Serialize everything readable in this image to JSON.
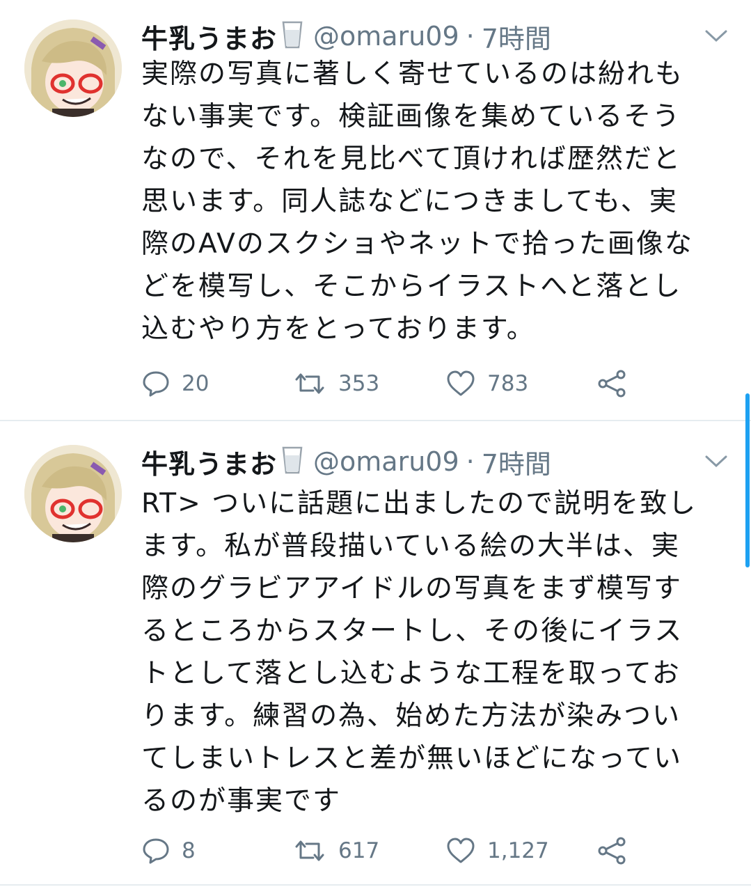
{
  "tweets": [
    {
      "name": "牛乳うまお",
      "name_emoji": "milk-glass-icon",
      "handle": "@omaru09",
      "separator": "·",
      "time": "7時間",
      "lines": [
        "実際の写真に著しく寄せているのは紛れも",
        "ない事実です。検証画像を集めているそう",
        "なので、それを見比べて頂ければ歴然だと",
        "思います。同人誌などにつきましても、実",
        "際のAVのスクショやネットで拾った画像な",
        "どを模写し、そこからイラストへと落とし",
        "込むやり方をとっております。"
      ],
      "reply_count": "20",
      "retweet_count": "353",
      "like_count": "783"
    },
    {
      "name": "牛乳うまお",
      "name_emoji": "milk-glass-icon",
      "handle": "@omaru09",
      "separator": "·",
      "time": "7時間",
      "lines": [
        "RT> ついに話題に出ましたので説明を致し",
        "ます。私が普段描いている絵の大半は、実",
        "際のグラビアアイドルの写真をまず模写す",
        "るところからスタートし、その後にイラス",
        "トとして落とし込むような工程を取ってお",
        "ります。練習の為、始めた方法が染みつい",
        "てしまいトレスと差が無いほどになってい",
        "るのが事実です"
      ],
      "reply_count": "8",
      "retweet_count": "617",
      "like_count": "1,127"
    }
  ],
  "colors": {
    "text": "#14171a",
    "secondary": "#657786",
    "divider": "#e6ecf0",
    "scrollbar": "#1da1f2"
  }
}
